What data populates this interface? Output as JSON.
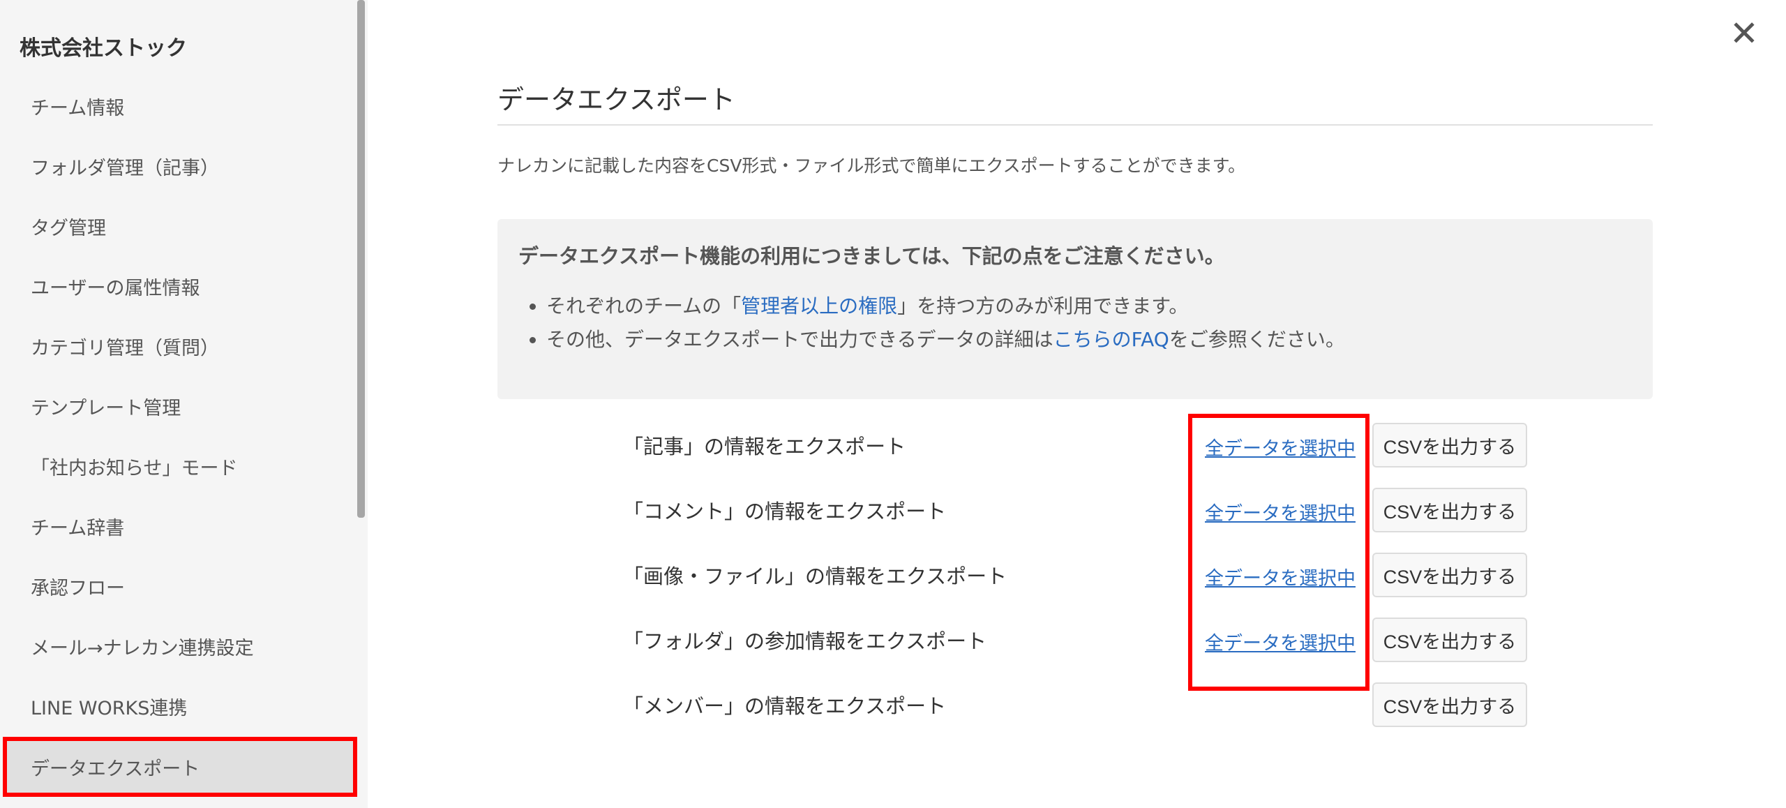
{
  "sidebar": {
    "company": "株式会社ストック",
    "items": [
      {
        "label": "チーム情報",
        "active": false
      },
      {
        "label": "フォルダ管理（記事）",
        "active": false
      },
      {
        "label": "タグ管理",
        "active": false
      },
      {
        "label": "ユーザーの属性情報",
        "active": false
      },
      {
        "label": "カテゴリ管理（質問）",
        "active": false
      },
      {
        "label": "テンプレート管理",
        "active": false
      },
      {
        "label": "「社内お知らせ」モード",
        "active": false
      },
      {
        "label": "チーム辞書",
        "active": false
      },
      {
        "label": "承認フロー",
        "active": false
      },
      {
        "label": "メール→ナレカン連携設定",
        "active": false
      },
      {
        "label": "LINE WORKS連携",
        "active": false
      },
      {
        "label": "データエクスポート",
        "active": true
      }
    ]
  },
  "close_icon": "close-icon",
  "main": {
    "title": "データエクスポート",
    "description": "ナレカンに記載した内容をCSV形式・ファイル形式で簡単にエクスポートすることができます。",
    "notice": {
      "heading": "データエクスポート機能の利用につきましては、下記の点をご注意ください。",
      "bullets": [
        {
          "before": "それぞれのチームの「",
          "link": "管理者以上の権限",
          "after": "」を持つ方のみが利用できます。"
        },
        {
          "before": "その他、データエクスポートで出力できるデータの詳細は",
          "link": "こちらのFAQ",
          "after": "をご参照ください。"
        }
      ]
    },
    "rows": [
      {
        "label": "「記事」の情報をエクスポート",
        "select": "全データを選択中",
        "button": "CSVを出力する"
      },
      {
        "label": "「コメント」の情報をエクスポート",
        "select": "全データを選択中",
        "button": "CSVを出力する"
      },
      {
        "label": "「画像・ファイル」の情報をエクスポート",
        "select": "全データを選択中",
        "button": "CSVを出力する"
      },
      {
        "label": "「フォルダ」の参加情報をエクスポート",
        "select": "全データを選択中",
        "button": "CSVを出力する"
      },
      {
        "label": "「メンバー」の情報をエクスポート",
        "select": "",
        "button": "CSVを出力する"
      }
    ]
  },
  "colors": {
    "highlight": "#ff0000",
    "link": "#2a6cc1",
    "sidebar_bg": "#f5f5f5",
    "notice_bg": "#f2f2f2"
  }
}
